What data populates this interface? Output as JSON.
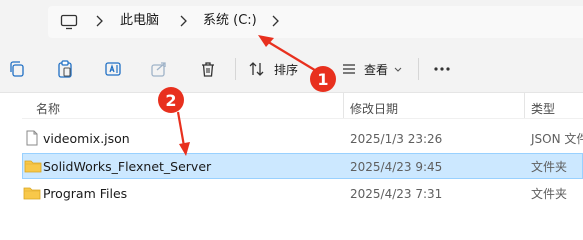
{
  "address_bar": {
    "crumbs": [
      "此电脑",
      "系统 (C:)"
    ]
  },
  "toolbar": {
    "sort_label": "排序",
    "view_label": "查看"
  },
  "columns": {
    "name": "名称",
    "modified": "修改日期",
    "type": "类型"
  },
  "files": [
    {
      "name": "videomix.json",
      "modified": "2025/1/3 23:26",
      "type": "JSON 文件",
      "icon": "json-file-icon"
    },
    {
      "name": "SolidWorks_Flexnet_Server",
      "modified": "2025/4/23 9:45",
      "type": "文件夹",
      "icon": "folder-icon"
    },
    {
      "name": "Program Files",
      "modified": "2025/4/23 7:31",
      "type": "文件夹",
      "icon": "folder-icon"
    }
  ],
  "annotations": {
    "badge1": "1",
    "badge2": "2",
    "color": "#e8301e"
  },
  "colors": {
    "selection": "#cce8ff",
    "folder": "#f8c84a"
  }
}
